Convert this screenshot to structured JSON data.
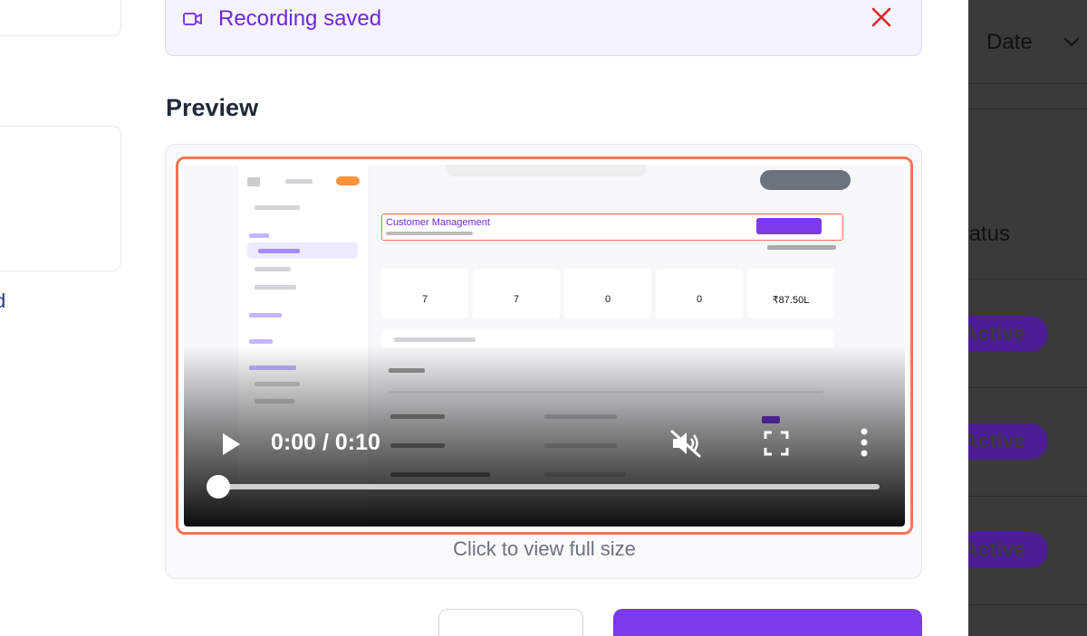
{
  "toast": {
    "text": "Recording saved"
  },
  "preview": {
    "title": "Preview",
    "hint": "Click to view full size",
    "video": {
      "time_display": "0:00 / 0:10",
      "progress": 0.0,
      "muted": true,
      "recorded_app": {
        "page_title": "Customer Management",
        "stats": [
          "7",
          "7",
          "0",
          "0",
          "₹87.50L"
        ]
      }
    }
  },
  "background_table": {
    "sort_label": "Date",
    "status_header": "tatus",
    "status_values": [
      "Active",
      "Active",
      "Active"
    ],
    "left_fragment": "d"
  },
  "colors": {
    "accent": "#7c3aed",
    "toast_bg": "#f5f3ff",
    "highlight": "#f97352",
    "close": "#dc2626"
  }
}
